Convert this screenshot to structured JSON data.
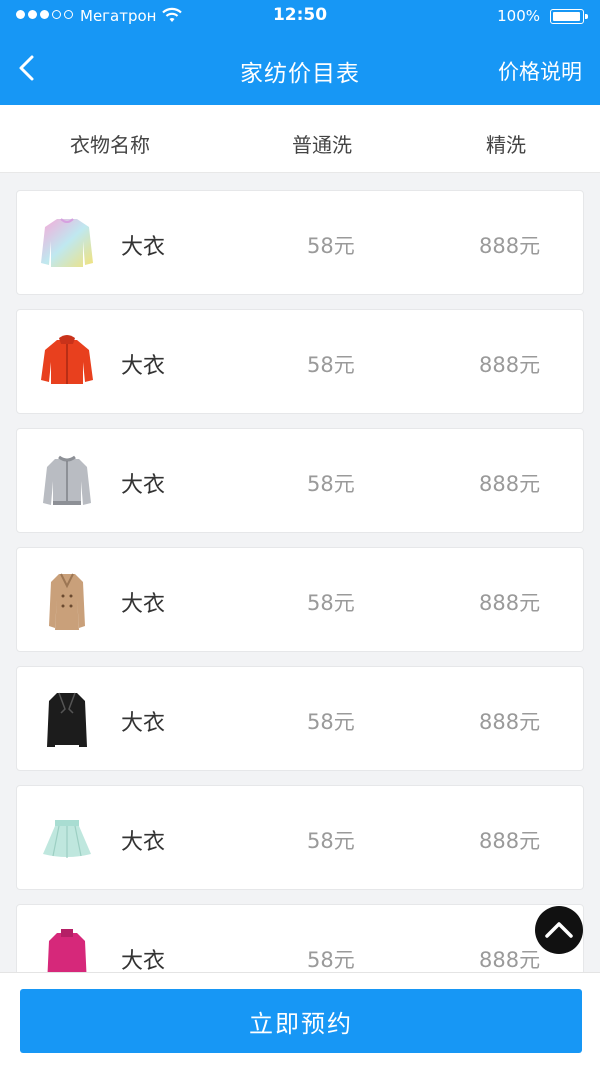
{
  "status_bar": {
    "carrier": "Мегатрон",
    "time": "12:50",
    "battery": "100%"
  },
  "nav": {
    "title": "家纺价目表",
    "action": "价格说明"
  },
  "columns": {
    "name": "衣物名称",
    "normal": "普通洗",
    "fine": "精洗"
  },
  "items": [
    {
      "name": "大衣",
      "normal_price": "58元",
      "fine_price": "888元",
      "icon": "sweatshirt-icon"
    },
    {
      "name": "大衣",
      "normal_price": "58元",
      "fine_price": "888元",
      "icon": "jacket-icon"
    },
    {
      "name": "大衣",
      "normal_price": "58元",
      "fine_price": "888元",
      "icon": "bomber-jacket-icon"
    },
    {
      "name": "大衣",
      "normal_price": "58元",
      "fine_price": "888元",
      "icon": "trench-coat-icon"
    },
    {
      "name": "大衣",
      "normal_price": "58元",
      "fine_price": "888元",
      "icon": "leather-jacket-icon"
    },
    {
      "name": "大衣",
      "normal_price": "58元",
      "fine_price": "888元",
      "icon": "skirt-icon"
    },
    {
      "name": "大衣",
      "normal_price": "58元",
      "fine_price": "888元",
      "icon": "sweater-icon"
    }
  ],
  "footer": {
    "button_label": "立即预约"
  },
  "colors": {
    "primary": "#1797f5",
    "background": "#f2f3f5",
    "price_text": "#9a9a9a"
  }
}
